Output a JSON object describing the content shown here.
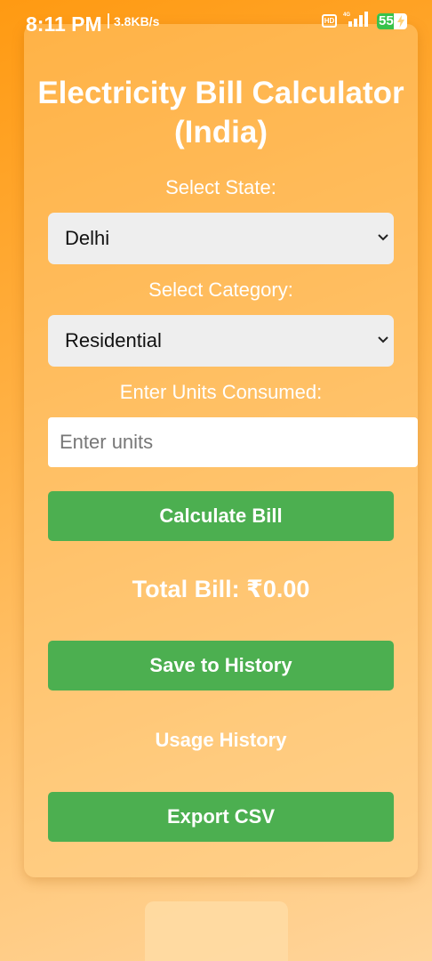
{
  "status_bar": {
    "time": "8:11 PM",
    "speed": "3.8KB/s",
    "hd_label": "HD",
    "network_label": "4G",
    "battery_level": "55"
  },
  "app": {
    "title": "Electricity Bill Calculator (India)",
    "state_label": "Select State:",
    "state_value": "Delhi",
    "category_label": "Select Category:",
    "category_value": "Residential",
    "units_label": "Enter Units Consumed:",
    "units_placeholder": "Enter units",
    "calculate_button": "Calculate Bill",
    "total_bill": "Total Bill: ₹0.00",
    "save_button": "Save to History",
    "history_heading": "Usage History",
    "export_button": "Export CSV"
  },
  "colors": {
    "accent_green": "#4caf50",
    "background_orange": "#ff9a12"
  }
}
